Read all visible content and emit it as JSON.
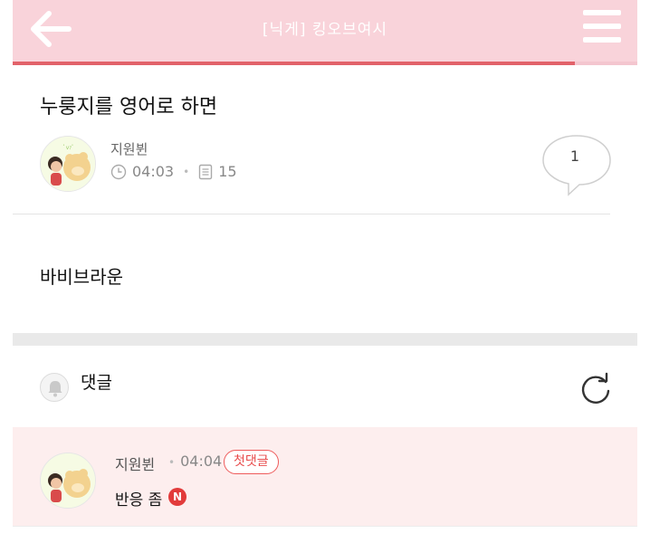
{
  "header": {
    "title": "[닉게] 킹오브여시",
    "progress_percent": 90,
    "accent_color": "#f9d3da",
    "progress_color": "#e2626a"
  },
  "icons": {
    "back": "back-arrow-icon",
    "menu": "hamburger-menu-icon",
    "clock": "clock-icon",
    "views": "document-icon",
    "comment_bubble": "speech-bubble-icon",
    "bell": "bell-icon",
    "refresh": "refresh-icon"
  },
  "post": {
    "title": "누룽지를 영어로 하면",
    "author": "지원뷘",
    "time": "04:03",
    "views": "15",
    "comment_count": "1",
    "body": "바비브라운"
  },
  "comments": {
    "label": "댓글",
    "items": [
      {
        "author": "지원뷘",
        "time": "04:04",
        "badge": "첫댓글",
        "text": "반응 좀",
        "new_badge": "N"
      }
    ]
  }
}
